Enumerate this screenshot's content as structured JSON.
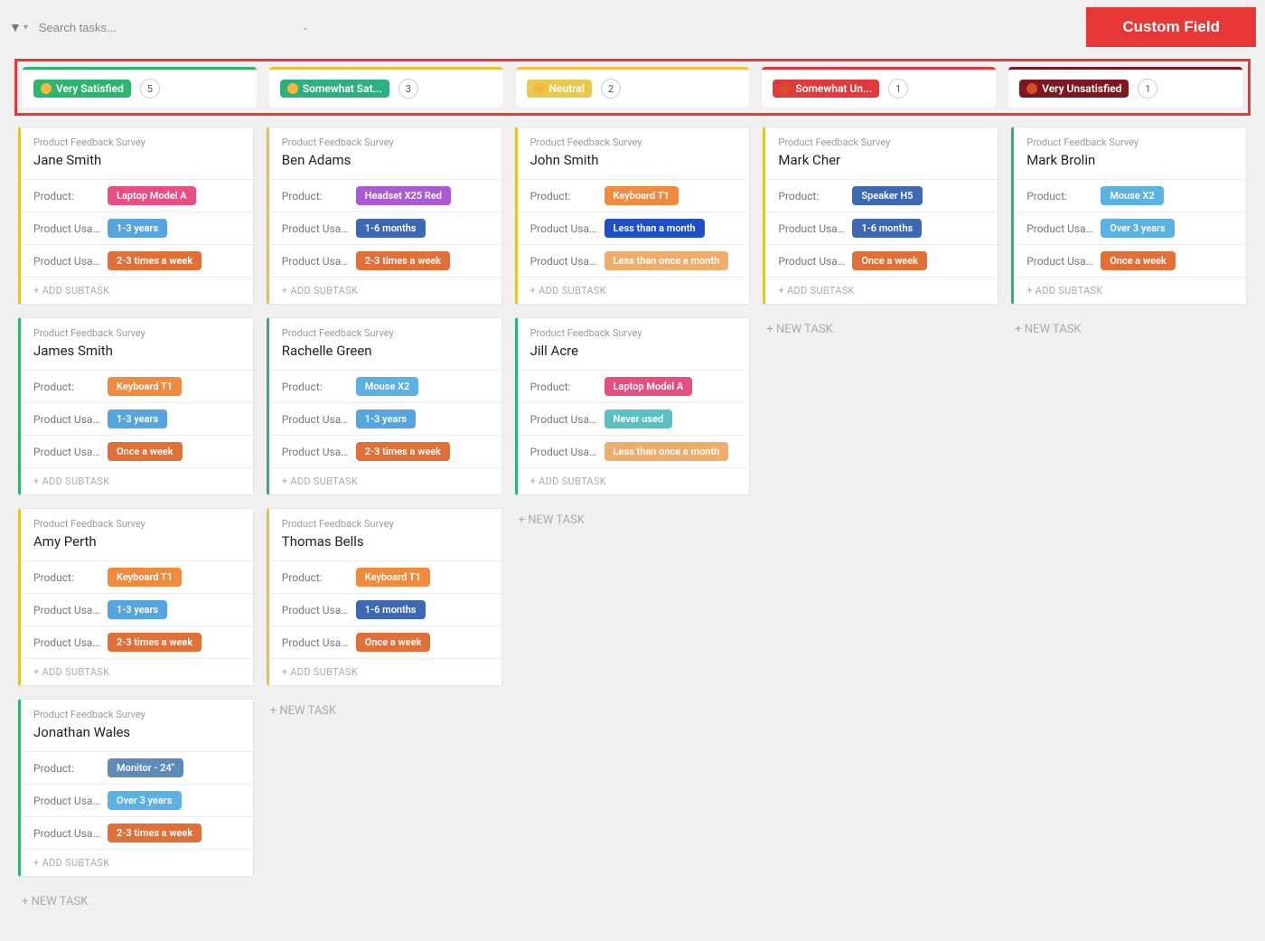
{
  "ui": {
    "search_placeholder": "Search tasks...",
    "custom_field_button": "Custom Field",
    "add_subtask": "+ ADD SUBTASK",
    "new_task": "+ NEW TASK"
  },
  "labels": {
    "product": "Product:",
    "usage_duration": "Product Usa...",
    "usage_frequency": "Product Usa..."
  },
  "columns": [
    {
      "id": "very_satisfied",
      "label": "Very Satisfied",
      "count": "5",
      "pill": "sp-green",
      "top": "green"
    },
    {
      "id": "somewhat_satisfied",
      "label": "Somewhat Sat...",
      "count": "3",
      "pill": "sp-lime",
      "top": "lime"
    },
    {
      "id": "neutral",
      "label": "Neutral",
      "count": "2",
      "pill": "sp-yellow",
      "top": "yellow"
    },
    {
      "id": "somewhat_unsat",
      "label": "Somewhat Un...",
      "count": "1",
      "pill": "sp-red",
      "top": "red"
    },
    {
      "id": "very_unsat",
      "label": "Very Unsatisfied",
      "count": "1",
      "pill": "sp-dark",
      "top": "dark"
    }
  ],
  "cards": {
    "very_satisfied": [
      {
        "list": "Product Feedback Survey",
        "name": "Jane Smith",
        "border": "bl-yellow",
        "product": {
          "text": "Laptop Model A",
          "color": "t-pink"
        },
        "duration": {
          "text": "1-3 years",
          "color": "t-lblue"
        },
        "frequency": {
          "text": "2-3 times a week",
          "color": "t-dorange"
        }
      },
      {
        "list": "Product Feedback Survey",
        "name": "James Smith",
        "border": "bl-green",
        "product": {
          "text": "Keyboard T1",
          "color": "t-orange"
        },
        "duration": {
          "text": "1-3 years",
          "color": "t-lblue"
        },
        "frequency": {
          "text": "Once a week",
          "color": "t-dorange"
        }
      },
      {
        "list": "Product Feedback Survey",
        "name": "Amy Perth",
        "border": "bl-yellow",
        "product": {
          "text": "Keyboard T1",
          "color": "t-orange"
        },
        "duration": {
          "text": "1-3 years",
          "color": "t-lblue"
        },
        "frequency": {
          "text": "2-3 times a week",
          "color": "t-dorange"
        }
      },
      {
        "list": "Product Feedback Survey",
        "name": "Jonathan Wales",
        "border": "bl-green",
        "product": {
          "text": "Monitor - 24\"",
          "color": "t-steel"
        },
        "duration": {
          "text": "Over 3 years",
          "color": "t-sky"
        },
        "frequency": {
          "text": "2-3 times a week",
          "color": "t-dorange"
        }
      }
    ],
    "somewhat_satisfied": [
      {
        "list": "Product Feedback Survey",
        "name": "Ben Adams",
        "border": "bl-yellow",
        "product": {
          "text": "Headset X25 Red",
          "color": "t-purple"
        },
        "duration": {
          "text": "1-6 months",
          "color": "t-royal"
        },
        "frequency": {
          "text": "2-3 times a week",
          "color": "t-dorange"
        }
      },
      {
        "list": "Product Feedback Survey",
        "name": "Rachelle Green",
        "border": "bl-green",
        "product": {
          "text": "Mouse X2",
          "color": "t-sky"
        },
        "duration": {
          "text": "1-3 years",
          "color": "t-lblue"
        },
        "frequency": {
          "text": "2-3 times a week",
          "color": "t-dorange"
        }
      },
      {
        "list": "Product Feedback Survey",
        "name": "Thomas Bells",
        "border": "bl-yellow",
        "product": {
          "text": "Keyboard T1",
          "color": "t-orange"
        },
        "duration": {
          "text": "1-6 months",
          "color": "t-royal"
        },
        "frequency": {
          "text": "Once a week",
          "color": "t-dorange"
        }
      }
    ],
    "neutral": [
      {
        "list": "Product Feedback Survey",
        "name": "John Smith",
        "border": "bl-yellow",
        "product": {
          "text": "Keyboard T1",
          "color": "t-orange"
        },
        "duration": {
          "text": "Less than a month",
          "color": "t-blue"
        },
        "frequency": {
          "text": "Less than once a month",
          "color": "t-peach"
        }
      },
      {
        "list": "Product Feedback Survey",
        "name": "Jill Acre",
        "border": "bl-green",
        "product": {
          "text": "Laptop Model A",
          "color": "t-pink"
        },
        "duration": {
          "text": "Never used",
          "color": "t-teal"
        },
        "frequency": {
          "text": "Less than once a month",
          "color": "t-peach"
        }
      }
    ],
    "somewhat_unsat": [
      {
        "list": "Product Feedback Survey",
        "name": "Mark Cher",
        "border": "bl-yellow",
        "product": {
          "text": "Speaker H5",
          "color": "t-royal"
        },
        "duration": {
          "text": "1-6 months",
          "color": "t-royal"
        },
        "frequency": {
          "text": "Once a week",
          "color": "t-dorange"
        }
      }
    ],
    "very_unsat": [
      {
        "list": "Product Feedback Survey",
        "name": "Mark Brolin",
        "border": "bl-green",
        "product": {
          "text": "Mouse X2",
          "color": "t-sky"
        },
        "duration": {
          "text": "Over 3 years",
          "color": "t-sky"
        },
        "frequency": {
          "text": "Once a week",
          "color": "t-dorange"
        }
      }
    ]
  }
}
